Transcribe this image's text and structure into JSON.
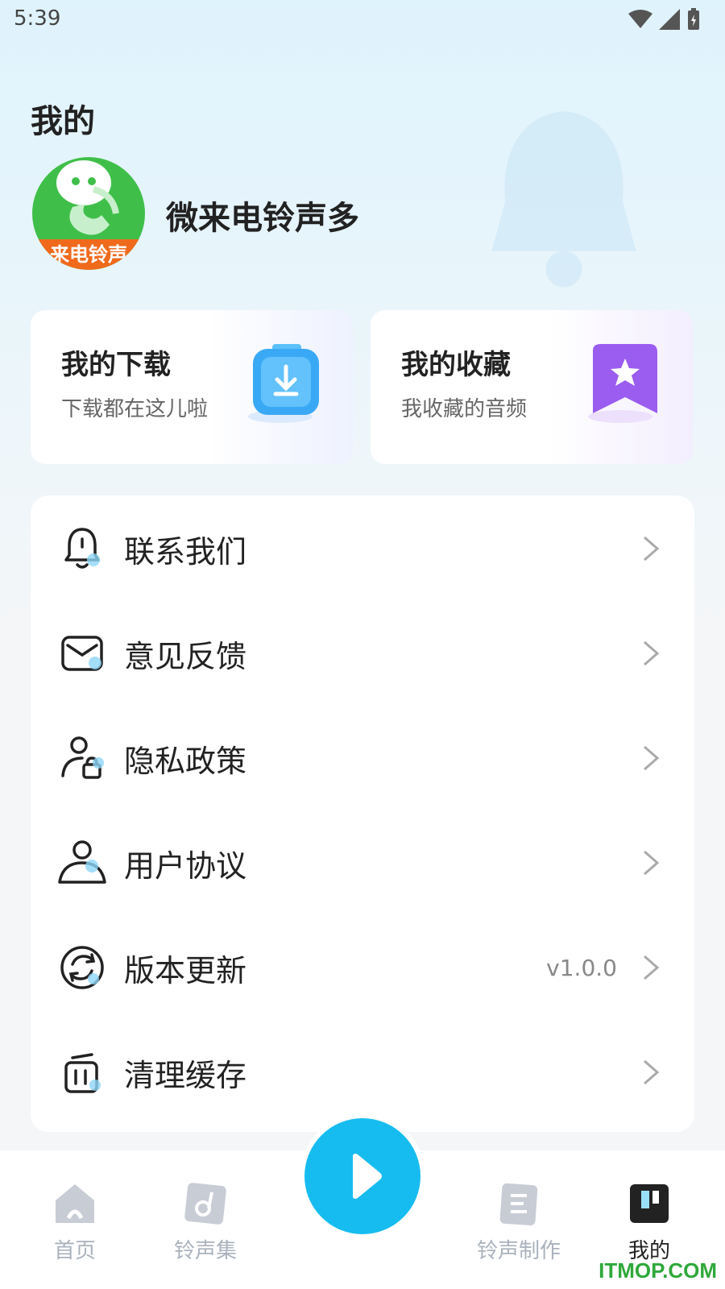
{
  "status": {
    "time": "5:39"
  },
  "header": {
    "title": "我的"
  },
  "profile": {
    "name": "微来电铃声多",
    "avatar_band": "来电铃声"
  },
  "cards": {
    "download": {
      "title": "我的下载",
      "subtitle": "下载都在这儿啦"
    },
    "favorite": {
      "title": "我的收藏",
      "subtitle": "我收藏的音频"
    }
  },
  "menu": {
    "items": [
      {
        "label": "联系我们",
        "icon": "bell-icon"
      },
      {
        "label": "意见反馈",
        "icon": "mail-icon"
      },
      {
        "label": "隐私政策",
        "icon": "user-lock-icon"
      },
      {
        "label": "用户协议",
        "icon": "user-icon"
      },
      {
        "label": "版本更新",
        "icon": "refresh-icon",
        "value": "v1.0.0"
      },
      {
        "label": "清理缓存",
        "icon": "trash-icon"
      }
    ]
  },
  "tabs": [
    {
      "label": "首页",
      "icon": "home-icon"
    },
    {
      "label": "铃声集",
      "icon": "music-icon"
    },
    {
      "label": "铃声制作",
      "icon": "edit-icon"
    },
    {
      "label": "我的",
      "icon": "profile-icon",
      "active": true
    }
  ],
  "watermark": "ITMOP.COM",
  "colors": {
    "accent": "#16bcf0",
    "download_icon": "#3aa9f5",
    "favorite_icon": "#9b5cf0"
  }
}
